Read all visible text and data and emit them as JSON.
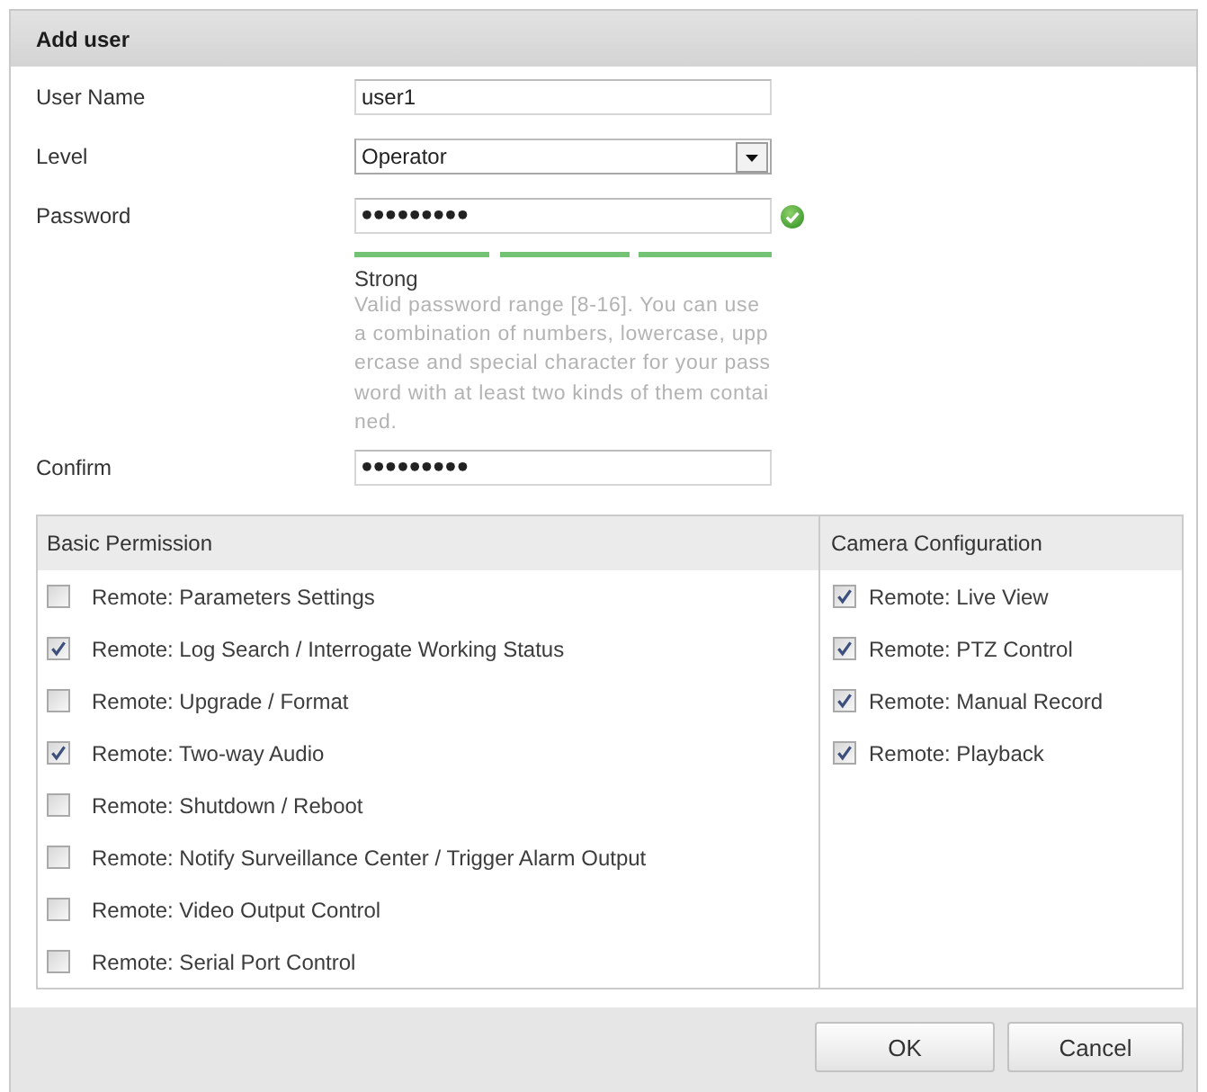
{
  "dialog": {
    "title": "Add user"
  },
  "form": {
    "fields": [
      {
        "kind": "text",
        "label": "User Name",
        "value": "user1"
      },
      {
        "kind": "select",
        "label": "Level",
        "value": "Operator"
      },
      {
        "kind": "password",
        "label": "Password",
        "value": "•••••••••",
        "valid": true,
        "strength": {
          "level": 1,
          "label": "Strong"
        },
        "hint": "Valid password range [8-16]. You can use a combination of numbers, lowercase, uppercase and special character for your password with at least two kinds of them contained."
      },
      {
        "kind": "password",
        "label": "Confirm",
        "value": "•••••••••"
      }
    ]
  },
  "permissions": [
    {
      "title": "Basic Permission",
      "items": [
        {
          "label": "Remote: Parameters Settings",
          "checked": false
        },
        {
          "label": "Remote: Log Search / Interrogate Working Status",
          "checked": true
        },
        {
          "label": "Remote: Upgrade / Format",
          "checked": false
        },
        {
          "label": "Remote: Two-way Audio",
          "checked": true
        },
        {
          "label": "Remote: Shutdown / Reboot",
          "checked": false
        },
        {
          "label": "Remote: Notify Surveillance Center / Trigger Alarm Output",
          "checked": false
        },
        {
          "label": "Remote: Video Output Control",
          "checked": false
        },
        {
          "label": "Remote: Serial Port Control",
          "checked": false
        }
      ]
    },
    {
      "title": "Camera Configuration",
      "items": [
        {
          "label": "Remote: Live View",
          "checked": true
        },
        {
          "label": "Remote: PTZ Control",
          "checked": true
        },
        {
          "label": "Remote: Manual Record",
          "checked": true
        },
        {
          "label": "Remote: Playback",
          "checked": true
        }
      ]
    }
  ],
  "buttons": [
    {
      "label": "OK"
    },
    {
      "label": "Cancel"
    }
  ]
}
